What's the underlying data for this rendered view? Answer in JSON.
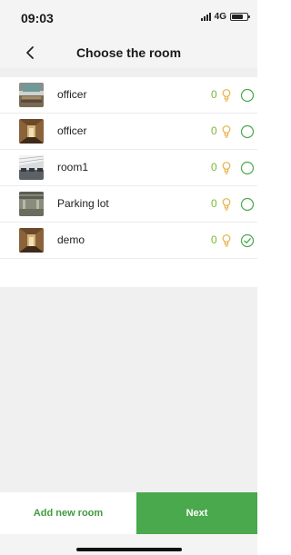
{
  "status_bar": {
    "time": "09:03",
    "network": "4G",
    "battery_level": 0.7
  },
  "nav": {
    "title": "Choose the room",
    "back_icon": "chevron-left-icon"
  },
  "rooms": [
    {
      "name": "officer",
      "count": "0",
      "selected": false,
      "thumb": "office"
    },
    {
      "name": "officer",
      "count": "0",
      "selected": false,
      "thumb": "corridor"
    },
    {
      "name": "room1",
      "count": "0",
      "selected": false,
      "thumb": "hall"
    },
    {
      "name": "Parking lot",
      "count": "0",
      "selected": false,
      "thumb": "parking"
    },
    {
      "name": "demo",
      "count": "0",
      "selected": true,
      "thumb": "corridor"
    }
  ],
  "footer": {
    "add_label": "Add new room",
    "next_label": "Next"
  },
  "colors": {
    "accent": "#4aa84d",
    "accent_text": "#3f9c3f",
    "bulb": "#e8b14a",
    "count": "#7ab833"
  }
}
